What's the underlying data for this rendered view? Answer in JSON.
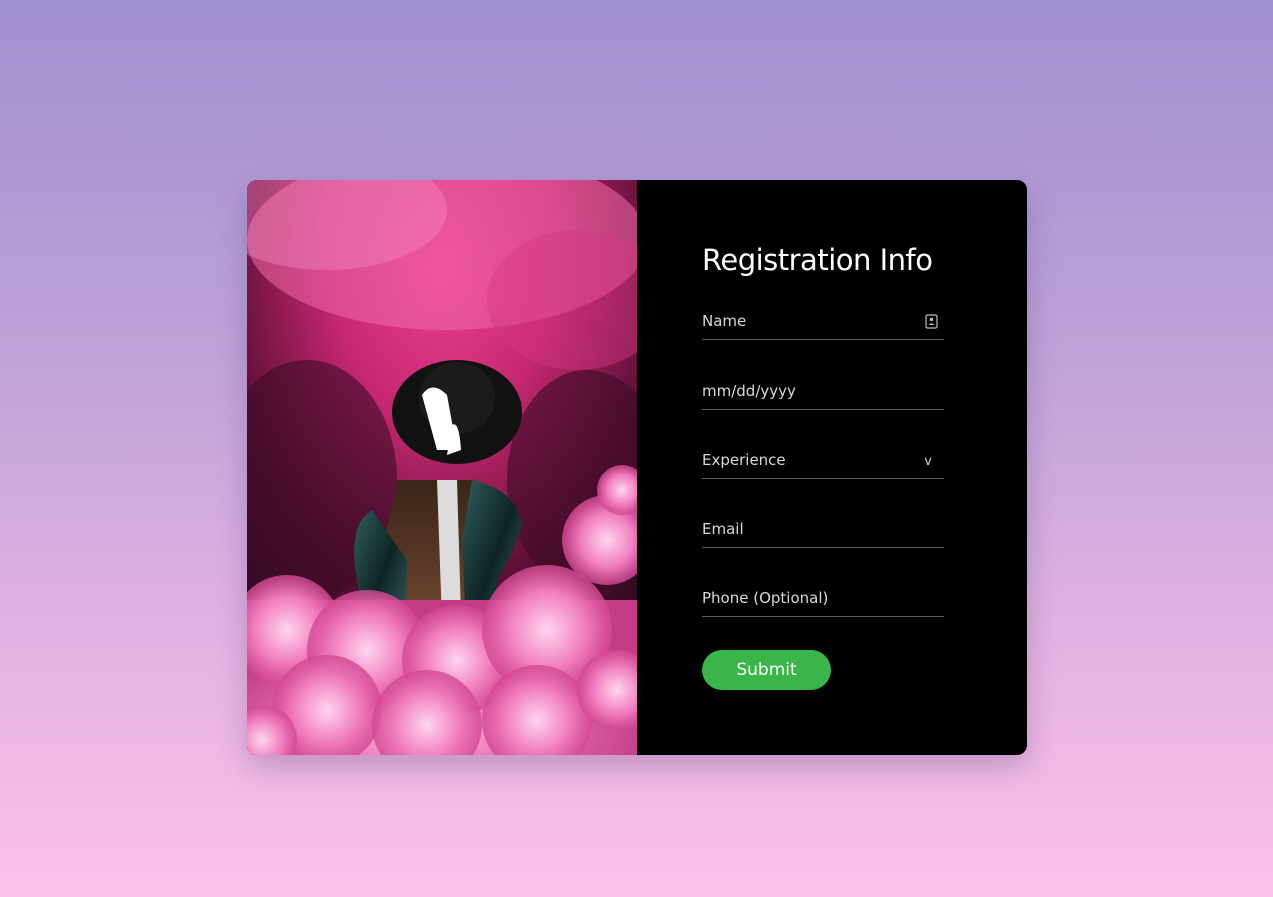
{
  "form": {
    "title": "Registration Info",
    "fields": {
      "name": {
        "placeholder": "Name",
        "icon": "contact-card-icon"
      },
      "date": {
        "placeholder": "mm/dd/yyyy"
      },
      "experience": {
        "placeholder": "Experience",
        "chevron": "v"
      },
      "email": {
        "placeholder": "Email"
      },
      "phone": {
        "placeholder": "Phone (Optional)"
      }
    },
    "submit_label": "Submit"
  },
  "colors": {
    "background_top": "#a190cf",
    "background_bottom": "#fcc2ea",
    "panel": "#000000",
    "submit": "#3ab54a"
  }
}
